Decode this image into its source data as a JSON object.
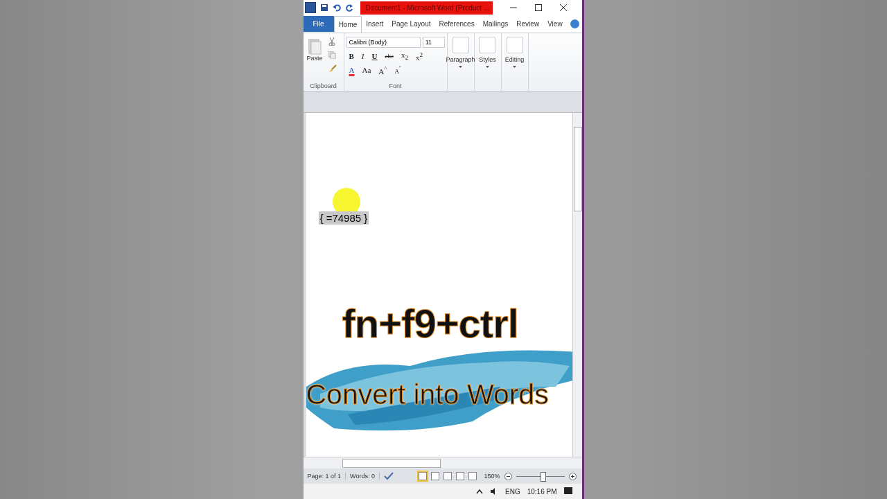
{
  "window": {
    "title": "Document1  -  Microsoft Word (Product ..."
  },
  "tabs": [
    {
      "label": "File",
      "kind": "file",
      "selected": false
    },
    {
      "label": "Home",
      "kind": "tab",
      "selected": true
    },
    {
      "label": "Insert",
      "kind": "tab",
      "selected": false
    },
    {
      "label": "Page Layout",
      "kind": "tab",
      "selected": false
    },
    {
      "label": "References",
      "kind": "tab",
      "selected": false
    },
    {
      "label": "Mailings",
      "kind": "tab",
      "selected": false
    },
    {
      "label": "Review",
      "kind": "tab",
      "selected": false
    },
    {
      "label": "View",
      "kind": "tab",
      "selected": false
    }
  ],
  "ribbon": {
    "clipboard": {
      "paste": "Paste",
      "label": "Clipboard"
    },
    "font": {
      "name": "Calibri (Body)",
      "size": "11",
      "label": "Font",
      "row1": [
        {
          "text": "B",
          "kind": "bold"
        },
        {
          "text": "I",
          "kind": "italic"
        },
        {
          "text": "U",
          "kind": "underline"
        },
        {
          "text": "abc",
          "kind": "strike"
        },
        {
          "text": "x$_{2}$",
          "kind": "plain"
        },
        {
          "text": "x$^{2}$",
          "kind": "plain"
        }
      ],
      "row2": [
        {
          "text": "A",
          "kind": "color"
        },
        {
          "text": "Aa",
          "kind": "plain"
        },
        {
          "text": "A$^{^}$",
          "kind": "plain"
        },
        {
          "text": "A$^{ˇ}$",
          "kind": "small"
        }
      ]
    },
    "groups": [
      "Paragraph",
      "Styles",
      "Editing"
    ]
  },
  "document": {
    "field_code": "{ =74985 }",
    "caption": "fn+f9+ctrl",
    "subtitle": "Convert into Words"
  },
  "status_bar": {
    "page": "Page: 1 of 1",
    "words": "Words: 0",
    "zoom": "150%",
    "zoom_slider": {
      "level": 0.55
    }
  },
  "taskbar": {
    "language": "ENG",
    "time": "10:16 PM"
  }
}
